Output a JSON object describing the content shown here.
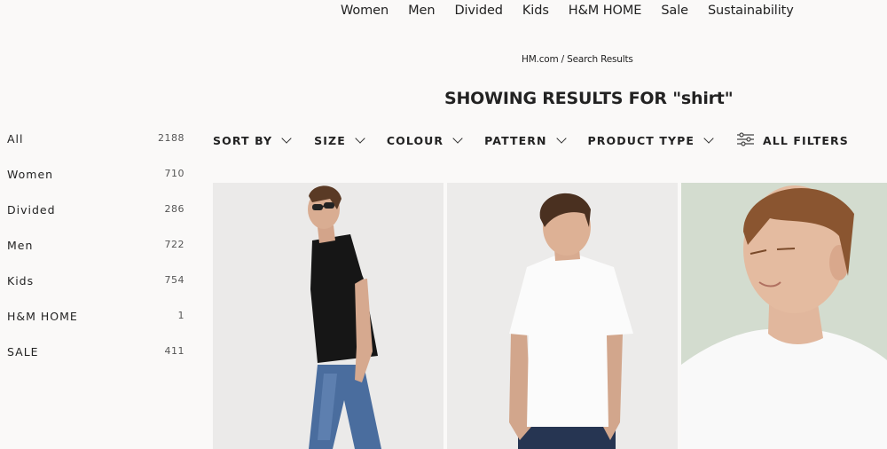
{
  "topnav": {
    "items": [
      "Women",
      "Men",
      "Divided",
      "Kids",
      "H&M HOME",
      "Sale",
      "Sustainability"
    ]
  },
  "breadcrumb": {
    "text": "HM.com / Search Results"
  },
  "page_title": "SHOWING RESULTS FOR \"shirt\"",
  "sidebar": {
    "items": [
      {
        "label": "All",
        "count": "2188"
      },
      {
        "label": "Women",
        "count": "710"
      },
      {
        "label": "Divided",
        "count": "286"
      },
      {
        "label": "Men",
        "count": "722"
      },
      {
        "label": "Kids",
        "count": "754"
      },
      {
        "label": "H&M HOME",
        "count": "1"
      },
      {
        "label": "SALE",
        "count": "411"
      }
    ]
  },
  "filters": {
    "sort_by": "SORT BY",
    "size": "SIZE",
    "colour": "COLOUR",
    "pattern": "PATTERN",
    "product_type": "PRODUCT TYPE",
    "all_filters": "ALL FILTERS",
    "icons": {
      "dropdown": "chevron-down-icon",
      "all_filters": "sliders-icon"
    }
  },
  "products": [
    {
      "image_desc": "Man in black t-shirt and blue jeans wearing sunglasses, walking"
    },
    {
      "image_desc": "Man in white t-shirt with hands in pockets"
    },
    {
      "image_desc": "Man in white t-shirt looking to the side, sage background"
    }
  ],
  "colors": {
    "background": "#faf9f8",
    "text": "#222222",
    "product_bg_gray": "#ebeae9",
    "product_bg_sage": "#d3dccf"
  }
}
